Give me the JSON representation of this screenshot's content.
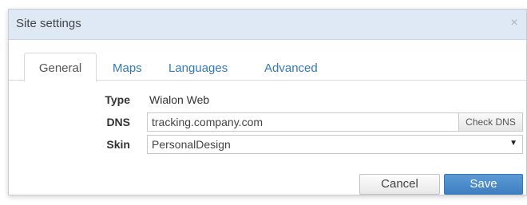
{
  "dialog": {
    "title": "Site settings",
    "close_glyph": "×",
    "close_icon": "close-icon"
  },
  "tabs": [
    {
      "label": "General",
      "active": true
    },
    {
      "label": "Maps",
      "active": false
    },
    {
      "label": "Languages",
      "active": false
    },
    {
      "label": "Advanced",
      "active": false
    }
  ],
  "form": {
    "type_label": "Type",
    "type_value": "Wialon Web",
    "dns_label": "DNS",
    "dns_value": "tracking.company.com",
    "check_dns_label": "Check DNS",
    "skin_label": "Skin",
    "skin_selected": "PersonalDesign",
    "skin_arrow": "▼"
  },
  "buttons": {
    "cancel_label": "Cancel",
    "save_label": "Save"
  },
  "colors": {
    "titlebar_bg": "#dfe9f5",
    "link_blue": "#337ab7",
    "save_blue": "#4a89c9"
  }
}
